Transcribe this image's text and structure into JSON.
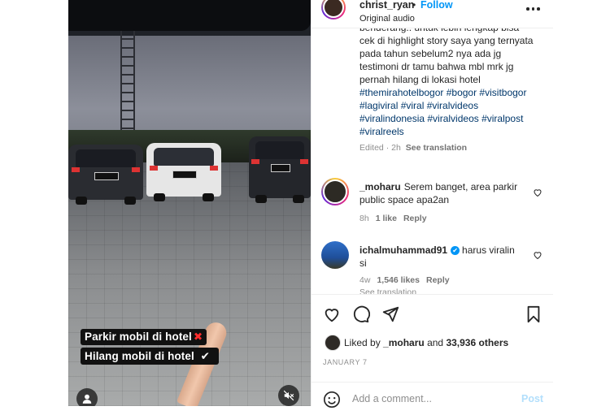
{
  "video": {
    "caption_line1": "Parkir mobil di hotel",
    "caption_line1_mark": "✖",
    "caption_line2": "Hilang mobil di hotel",
    "caption_line2_mark": "✔",
    "user_button_icon": "user-icon",
    "mute_button_icon": "speaker-muted-icon"
  },
  "header": {
    "username": "christ_ryan",
    "separator": "•",
    "follow_label": "Follow",
    "audio_label": "Original audio",
    "more_icon": "more-horizontal-icon"
  },
  "post_caption": {
    "text_cut": "benderang.. untuk lebih lengkap bisa",
    "text_rest": "cek di highlight story saya yang ternyata pada tahun sebelum2 nya ada jg testimoni dr tamu bahwa mbl mrk jg pernah hilang di lokasi hotel",
    "hashtags": "#themirahotelbogor #bogor #visitbogor #lagiviral #viral #viralvideos #viralindonesia #viralvideos #viralpost #viralreels",
    "edited_time": "Edited · 2h",
    "see_translation": "See translation"
  },
  "comments": [
    {
      "username": "_moharu",
      "text": "Serem banget, area parkir public space apa2an",
      "time": "8h",
      "likes": "1 like",
      "reply_label": "Reply",
      "verified": false
    },
    {
      "username": "ichalmuhammad91",
      "text": "harus viralin si",
      "time": "4w",
      "likes": "1,546 likes",
      "reply_label": "Reply",
      "see_translation": "See translation",
      "verified": true,
      "verified_icon": "✔"
    }
  ],
  "actions": {
    "like_icon": "heart-icon",
    "comment_icon": "comment-icon",
    "share_icon": "send-icon",
    "save_icon": "bookmark-icon"
  },
  "likes": {
    "prefix": "Liked by",
    "user": "_moharu",
    "middle": "and",
    "others": "33,936 others"
  },
  "date": "JANUARY 7",
  "comment_box": {
    "placeholder": "Add a comment...",
    "post_label": "Post",
    "emoji_icon": "smiley-icon"
  },
  "colors": {
    "accent": "#0095f6",
    "post_disabled": "#b2dffc",
    "muted_text": "#8e8e8e",
    "hashtag": "#00376b"
  }
}
